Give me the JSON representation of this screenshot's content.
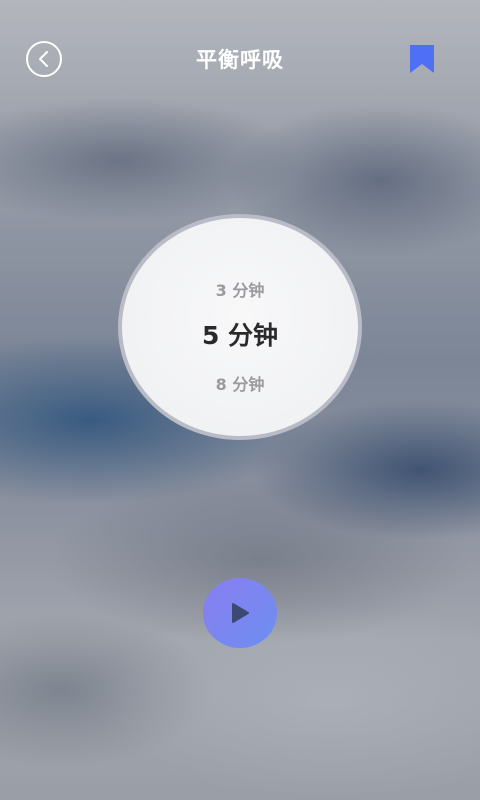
{
  "header": {
    "title": "平衡呼吸",
    "back_icon": "chevron-left-circle-icon",
    "bookmark_icon": "bookmark-icon"
  },
  "duration_picker": {
    "options": [
      "3 分钟",
      "5 分钟",
      "8 分钟"
    ],
    "selected": "5 分钟"
  },
  "controls": {
    "play_icon": "play-icon"
  },
  "colors": {
    "bookmark": "#4f6ff5",
    "play_button_start": "#8a7df0",
    "play_button_end": "#6c8ff0",
    "selected_text": "#2a2a2c",
    "muted_text": "#9a9a9d"
  }
}
